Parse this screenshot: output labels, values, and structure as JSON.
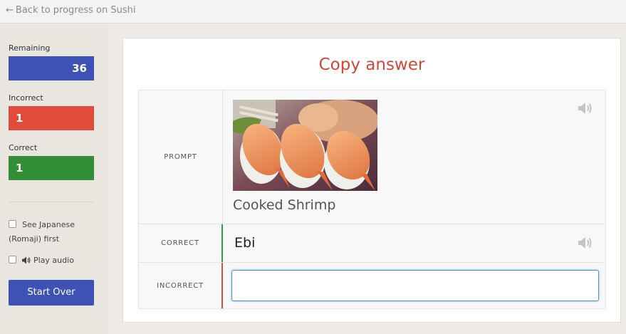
{
  "topbar": {
    "back_label": "Back to progress on Sushi"
  },
  "sidebar": {
    "remaining_label": "Remaining",
    "remaining_value": "36",
    "incorrect_label": "Incorrect",
    "incorrect_value": "1",
    "correct_label": "Correct",
    "correct_value": "1",
    "see_japanese_line1": "See Japanese",
    "see_japanese_line2": "(Romaji) first",
    "play_audio_label": "Play audio",
    "start_over_label": "Start Over"
  },
  "card": {
    "title": "Copy answer",
    "prompt_label": "PROMPT",
    "prompt_text": "Cooked Shrimp",
    "correct_label": "CORRECT",
    "correct_answer": "Ebi",
    "incorrect_label": "INCORRECT",
    "answer_input_value": ""
  },
  "colors": {
    "remaining": "#3e51b5",
    "incorrect": "#e14b3a",
    "correct": "#338f37",
    "title": "#d64535"
  }
}
